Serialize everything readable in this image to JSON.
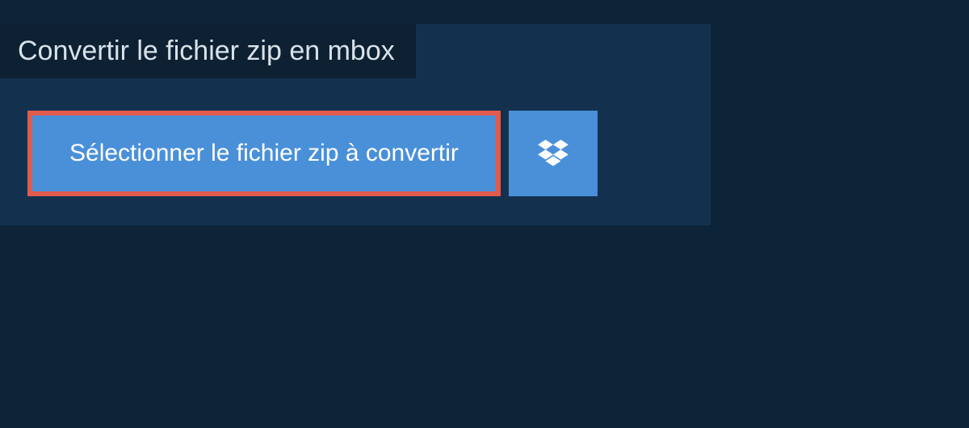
{
  "header": {
    "title": "Convertir le fichier zip en mbox"
  },
  "actions": {
    "select_file_label": "Sélectionner le fichier zip à convertir"
  }
}
